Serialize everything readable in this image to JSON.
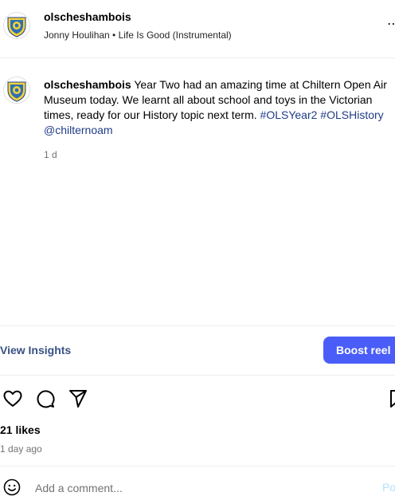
{
  "post": {
    "header": {
      "username": "olscheshambois",
      "audio": "Jonny Houlihan • Life Is Good (Instrumental)",
      "more_icon": "more-horizontal-icon"
    },
    "caption": {
      "username": "olscheshambois",
      "text": "Year Two had an amazing time at Chiltern Open Air Museum today. We learnt all about school and toys in the Victorian times, ready for our History topic next term.",
      "hashtag_1": "#OLSYear2",
      "hashtag_2": "#OLSHistory",
      "mention": "@chilternoam",
      "time": "1 d"
    },
    "insights": {
      "view_label": "View Insights",
      "boost_label": "Boost reel"
    },
    "actions": {
      "like_icon": "heart-icon",
      "comment_icon": "comment-icon",
      "share_icon": "send-icon",
      "save_icon": "bookmark-icon"
    },
    "likes": "21 likes",
    "time_ago": "1 day ago",
    "comment_box": {
      "placeholder": "Add a comment...",
      "post_label": "Post",
      "emoji_icon": "emoji-icon"
    }
  },
  "colors": {
    "boost_button": "#4a5df9",
    "hashtag": "#1f3c88",
    "crest_blue": "#2f6fb2",
    "crest_yellow": "#f2d33a"
  }
}
